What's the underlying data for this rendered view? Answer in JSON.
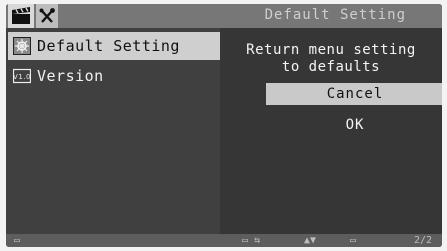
{
  "header": {
    "title": "Default Setting",
    "tabs": [
      {
        "icon": "movie-clapper-icon",
        "selected": true
      },
      {
        "icon": "wrench-tools-icon",
        "selected": false
      }
    ]
  },
  "menu": {
    "items": [
      {
        "label": "Default Setting",
        "icon": "reset-settings-icon",
        "selected": true
      },
      {
        "label": "Version",
        "icon": "version-v1-icon",
        "icon_text": "V1.0",
        "selected": false
      }
    ]
  },
  "dialog": {
    "message_line1": "Return menu setting",
    "message_line2": "to defaults",
    "cancel_label": "Cancel",
    "ok_label": "OK"
  },
  "footer": {
    "page": "2/2"
  }
}
